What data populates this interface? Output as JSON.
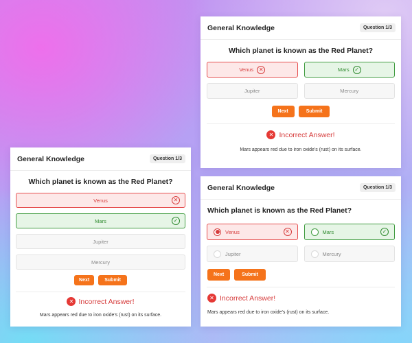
{
  "colors": {
    "accent": "#f5731b",
    "wrong": "#d63b3b",
    "wrong_bg": "#fde8e8",
    "correct": "#2e8a2e",
    "correct_bg": "#e6f5e6",
    "error_icon_bg": "#e53935"
  },
  "icons": {
    "wrong_option": "x-circle-icon",
    "correct_option": "check-circle-icon",
    "result": "error-circle-icon",
    "radio": "radio-icon"
  },
  "cards": [
    {
      "id": "vertical-layout",
      "title": "General Knowledge",
      "badge": "Question 1/3",
      "question": "Which planet is known as the Red Planet?",
      "options": [
        {
          "label": "Venus",
          "state": "wrong"
        },
        {
          "label": "Mars",
          "state": "correct"
        },
        {
          "label": "Jupiter",
          "state": "neutral"
        },
        {
          "label": "Mercury",
          "state": "neutral"
        }
      ],
      "buttons": {
        "next": "Next",
        "submit": "Submit"
      },
      "result": "Incorrect Answer!",
      "explanation": "Mars appears red due to iron oxide's (rust) on its surface."
    },
    {
      "id": "grid-layout",
      "title": "General Knowledge",
      "badge": "Question 1/3",
      "question": "Which planet is known as the Red Planet?",
      "options": [
        {
          "label": "Venus",
          "state": "wrong"
        },
        {
          "label": "Mars",
          "state": "correct"
        },
        {
          "label": "Jupiter",
          "state": "neutral"
        },
        {
          "label": "Mercury",
          "state": "neutral"
        }
      ],
      "buttons": {
        "next": "Next",
        "submit": "Submit"
      },
      "result": "Incorrect Answer!",
      "explanation": "Mars appears red due to iron oxide's (rust) on its surface."
    },
    {
      "id": "radio-layout",
      "title": "General Knowledge",
      "badge": "Question 1/3",
      "question": "Which planet is known as the Red Planet?",
      "options": [
        {
          "label": "Venus",
          "state": "wrong",
          "selected": true
        },
        {
          "label": "Mars",
          "state": "correct",
          "selected": false
        },
        {
          "label": "Jupiter",
          "state": "neutral",
          "selected": false
        },
        {
          "label": "Mercury",
          "state": "neutral",
          "selected": false
        }
      ],
      "buttons": {
        "next": "Next",
        "submit": "Submit"
      },
      "result": "Incorrect Answer!",
      "explanation": "Mars appears red due to iron oxide's (rust) on its surface."
    }
  ]
}
